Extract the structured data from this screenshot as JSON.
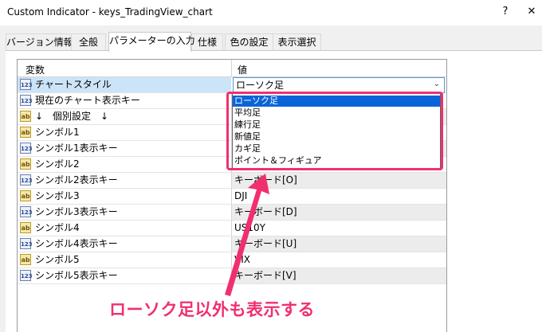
{
  "window": {
    "title": "Custom Indicator - keys_TradingView_chart",
    "help_label": "?",
    "close_label": "✕"
  },
  "tabs": [
    {
      "label": "バージョン情報",
      "active": false
    },
    {
      "label": "全般",
      "active": false
    },
    {
      "label": "パラメーターの入力",
      "active": true
    },
    {
      "label": "仕様",
      "active": false
    },
    {
      "label": "色の設定",
      "active": false
    },
    {
      "label": "表示選択",
      "active": false
    }
  ],
  "grid": {
    "header_variable": "変数",
    "header_value": "値",
    "rows": [
      {
        "icon": "123",
        "label": "チャートスタイル",
        "value": "ローソク足"
      },
      {
        "icon": "123",
        "label": "現在のチャート表示キー",
        "value": ""
      },
      {
        "icon": "ab",
        "label": "↓　個別設定　↓",
        "value": ""
      },
      {
        "icon": "ab",
        "label": "シンボル1",
        "value": ""
      },
      {
        "icon": "123",
        "label": "シンボル1表示キー",
        "value": ""
      },
      {
        "icon": "ab",
        "label": "シンボル2",
        "value": ""
      },
      {
        "icon": "123",
        "label": "シンボル2表示キー",
        "value": "キーボード[O]"
      },
      {
        "icon": "ab",
        "label": "シンボル3",
        "value": "DJI"
      },
      {
        "icon": "123",
        "label": "シンボル3表示キー",
        "value": "キーボード[D]"
      },
      {
        "icon": "ab",
        "label": "シンボル4",
        "value": "US10Y"
      },
      {
        "icon": "123",
        "label": "シンボル4表示キー",
        "value": "キーボード[U]"
      },
      {
        "icon": "ab",
        "label": "シンボル5",
        "value": "VIX"
      },
      {
        "icon": "123",
        "label": "シンボル5表示キー",
        "value": "キーボード[V]"
      }
    ]
  },
  "dropdown": {
    "options": [
      "ローソク足",
      "平均足",
      "練行足",
      "新値足",
      "カギ足",
      "ポイント＆フィギュア"
    ],
    "selected_index": 0,
    "arrow_icon": "chevron-down-icon"
  },
  "annotation": {
    "text": "ローソク足以外も表示する",
    "color": "#f0306e"
  },
  "colors": {
    "highlight": "#f0306e",
    "selection": "#0a64d8",
    "row_selected": "#cce4f7"
  }
}
